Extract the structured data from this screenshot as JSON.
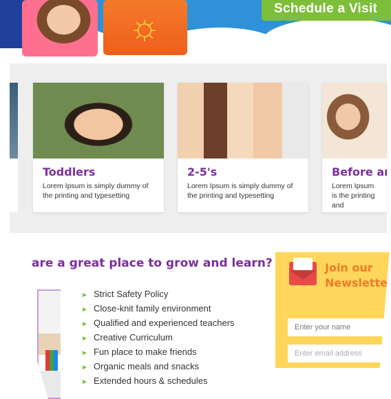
{
  "hero": {
    "schedule_label": "Schedule a Visit"
  },
  "programs": [
    {
      "title": "Toddlers",
      "text": "Lorem Ipsum is simply dummy of the printing and typesetting"
    },
    {
      "title": "2-5's",
      "text": "Lorem Ipsum is simply dummy of the printing and typesetting"
    },
    {
      "title": "Before an",
      "text": "Lorem Ipsum is the printing and"
    }
  ],
  "why": {
    "title": "are a great place to grow and learn?",
    "features": [
      "Strict Safety Policy",
      "Close-knit family environment",
      "Qualified and experienced teachers",
      "Creative Curriculum",
      "Fun place to make friends",
      "Organic meals and snacks",
      "Extended hours &  schedules"
    ]
  },
  "newsletter": {
    "title_line1": "Join our",
    "title_line2": "Newsletter",
    "name_placeholder": "Enter your name",
    "email_placeholder": "Enter email address"
  },
  "colors": {
    "purple": "#7b2f9c",
    "green": "#7dbe3a",
    "orange": "#f07a2a",
    "yellow": "#ffd65a"
  }
}
